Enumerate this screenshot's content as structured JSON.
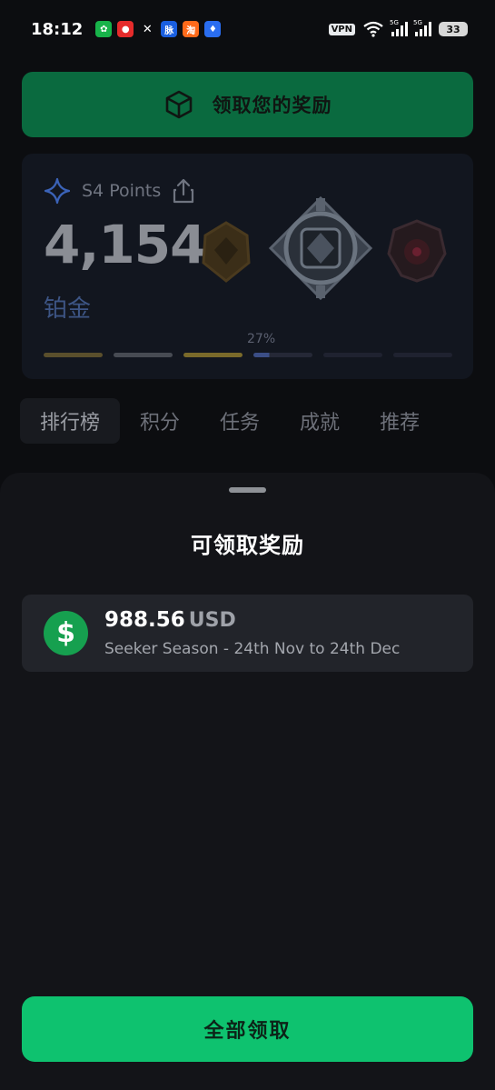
{
  "status_bar": {
    "time": "18:12",
    "notification_icons": [
      "wechat-icon",
      "app-red-icon",
      "x-icon",
      "maimai-icon",
      "taobao-icon",
      "baidu-icon"
    ],
    "vpn": "VPN",
    "signal1_label": "5G",
    "signal2_label": "5G",
    "battery": "33"
  },
  "background": {
    "claim_banner_label": "领取您的奖励",
    "points": {
      "label": "S4 Points",
      "value": "4,154",
      "tier": "铂金",
      "progress_label": "27%",
      "progress": 0.27
    },
    "tabs": [
      "排行榜",
      "积分",
      "任务",
      "成就",
      "推荐"
    ],
    "colors": {
      "banner": "#0a6a3f",
      "accent_green": "#0ec26f"
    }
  },
  "sheet": {
    "title": "可领取奖励",
    "reward": {
      "coin_symbol": "$",
      "amount": "988.56",
      "currency": "USD",
      "description": "Seeker Season - 24th Nov to 24th Dec"
    },
    "claim_all_label": "全部领取"
  }
}
